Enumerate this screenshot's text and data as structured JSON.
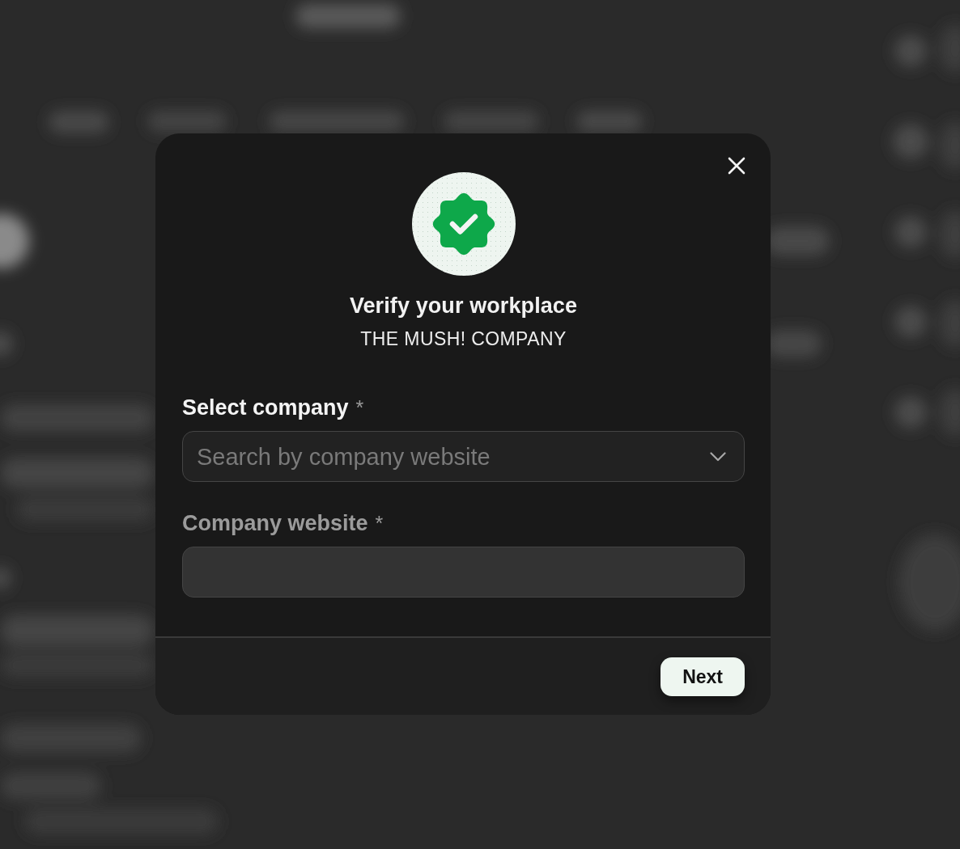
{
  "dialog": {
    "title": "Verify your workplace",
    "subtitle": "THE MUSH! COMPANY"
  },
  "fields": [
    {
      "kind": "select",
      "label": "Select company",
      "required_mark": "*",
      "placeholder": "Search by company website",
      "disabled": false
    },
    {
      "kind": "text",
      "label": "Company website",
      "required_mark": "*",
      "disabled": true
    }
  ],
  "footer": {
    "buttons": [
      {
        "label": "Next"
      }
    ]
  }
}
